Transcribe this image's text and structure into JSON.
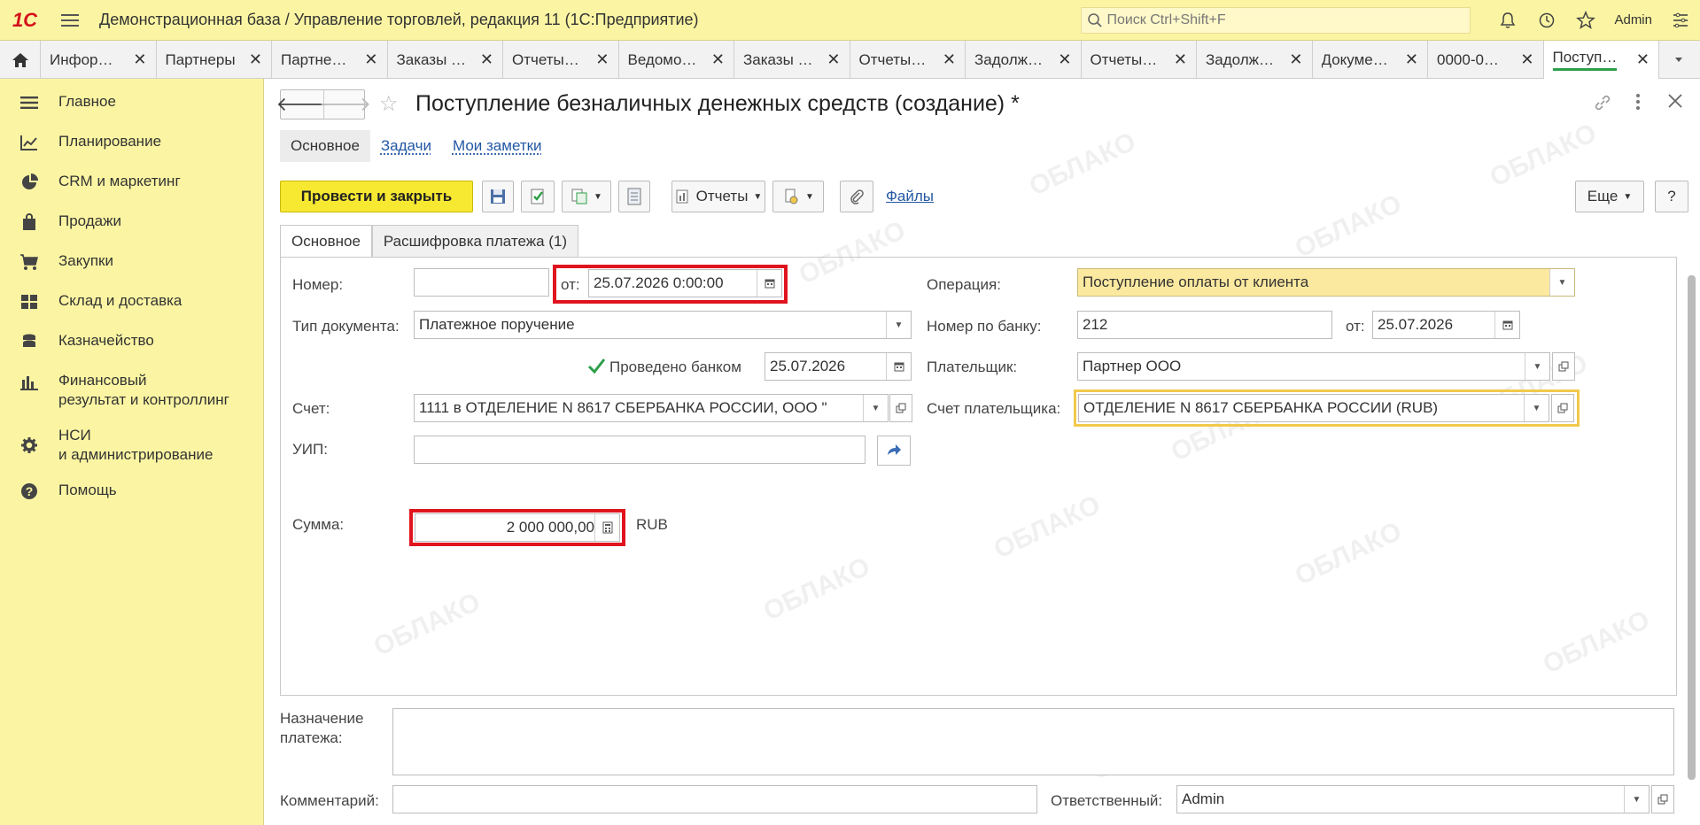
{
  "app": {
    "logo": "1С",
    "title": "Демонстрационная база / Управление торговлей, редакция 11  (1С:Предприятие)",
    "search_placeholder": "Поиск Ctrl+Shift+F",
    "user": "Admin"
  },
  "tabs": [
    {
      "label": "Инфор…"
    },
    {
      "label": "Партнеры"
    },
    {
      "label": "Партне…"
    },
    {
      "label": "Заказы …"
    },
    {
      "label": "Отчеты…"
    },
    {
      "label": "Ведомо…"
    },
    {
      "label": "Заказы …"
    },
    {
      "label": "Отчеты…"
    },
    {
      "label": "Задолж…"
    },
    {
      "label": "Отчеты…"
    },
    {
      "label": "Задолж…"
    },
    {
      "label": "Докуме…"
    },
    {
      "label": "0000-0…"
    },
    {
      "label": "Поступ…"
    }
  ],
  "sidebar": {
    "items": [
      {
        "label": "Главное",
        "icon": "menu-lines-icon"
      },
      {
        "label": "Планирование",
        "icon": "chart-trend-icon"
      },
      {
        "label": "CRM и маркетинг",
        "icon": "pie-chart-icon"
      },
      {
        "label": "Продажи",
        "icon": "shopping-bag-icon"
      },
      {
        "label": "Закупки",
        "icon": "cart-icon"
      },
      {
        "label": "Склад и доставка",
        "icon": "warehouse-icon"
      },
      {
        "label": "Казначейство",
        "icon": "coins-icon"
      },
      {
        "label": "Финансовый\nрезультат и контроллинг",
        "icon": "bar-chart-icon"
      },
      {
        "label": "НСИ\nи администрирование",
        "icon": "gear-icon"
      },
      {
        "label": "Помощь",
        "icon": "help-icon"
      }
    ]
  },
  "document": {
    "title": "Поступление безналичных денежных средств (создание) *",
    "subtabs": [
      "Основное",
      "Задачи",
      "Мои заметки"
    ]
  },
  "toolbar": {
    "post_close": "Провести и закрыть",
    "reports": "Отчеты",
    "files": "Файлы",
    "more": "Еще",
    "help": "?"
  },
  "form_tabs": [
    "Основное",
    "Расшифровка платежа (1)"
  ],
  "form": {
    "number_label": "Номер:",
    "number_value": "",
    "from_label": "от:",
    "date_value": "25.07.2026  0:00:00",
    "operation_label": "Операция:",
    "operation_value": "Поступление оплаты от клиента",
    "doc_type_label": "Тип документа:",
    "doc_type_value": "Платежное поручение",
    "bank_number_label": "Номер по банку:",
    "bank_number_value": "212",
    "bank_from_label": "от:",
    "bank_date_value": "25.07.2026",
    "bank_posted_label": "Проведено банком",
    "bank_posted_date": "25.07.2026",
    "bank_posted_checked": true,
    "payer_label": "Плательщик:",
    "payer_value": "Партнер ООО",
    "account_label": "Счет:",
    "account_value": "1111 в ОТДЕЛЕНИЕ N 8617 СБЕРБАНКА РОССИИ, ООО \"",
    "payer_account_label": "Счет плательщика:",
    "payer_account_value": "ОТДЕЛЕНИЕ N 8617 СБЕРБАНКА РОССИИ (RUB)",
    "uip_label": "УИП:",
    "uip_value": "",
    "sum_label": "Сумма:",
    "sum_value": "2 000 000,00",
    "currency": "RUB",
    "purpose_label_1": "Назначение",
    "purpose_label_2": "платежа:",
    "purpose_value": "",
    "comment_label": "Комментарий:",
    "comment_value": "",
    "responsible_label": "Ответственный:",
    "responsible_value": "Admin"
  },
  "watermark": "ОБЛАКО",
  "colors": {
    "sidebar_bg": "#fbf5a3",
    "primary_button": "#f7e832",
    "highlight_red": "#e0141e",
    "highlight_yellow": "#f2c94c",
    "operation_field_bg": "#fbe9a0",
    "link": "#2358a4"
  }
}
